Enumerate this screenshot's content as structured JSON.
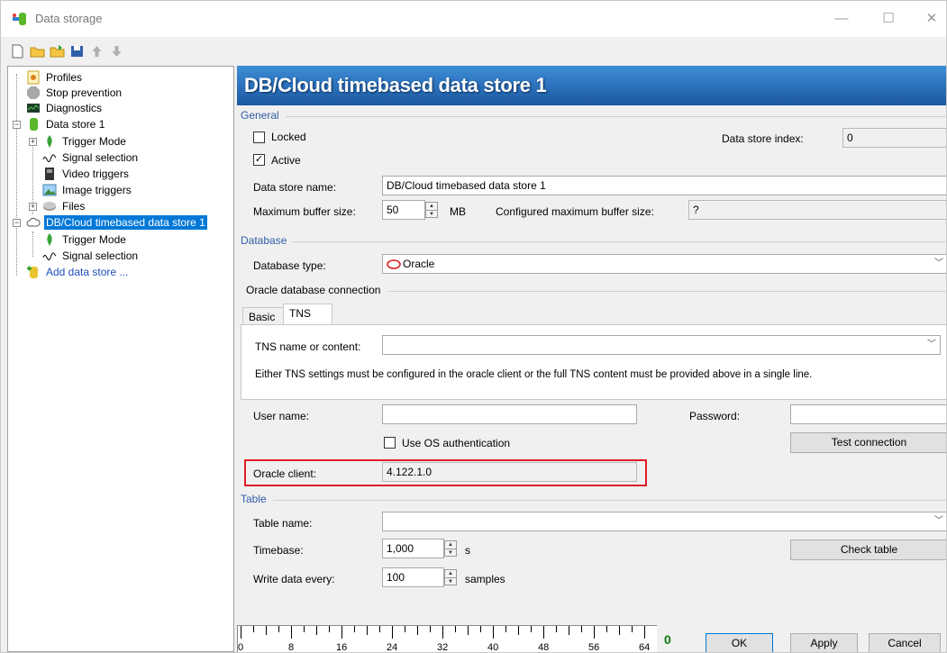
{
  "window": {
    "title": "Data storage",
    "minimize": "—",
    "maximize": "☐",
    "close": "✕"
  },
  "tree": {
    "items": [
      {
        "label": "Profiles"
      },
      {
        "label": "Stop prevention"
      },
      {
        "label": "Diagnostics"
      },
      {
        "label": "Data store 1"
      },
      {
        "label": "Trigger Mode"
      },
      {
        "label": "Signal selection"
      },
      {
        "label": "Video triggers"
      },
      {
        "label": "Image triggers"
      },
      {
        "label": "Files"
      },
      {
        "label": "DB/Cloud timebased data store 1"
      },
      {
        "label": "Trigger Mode"
      },
      {
        "label": "Signal selection"
      },
      {
        "label": "Add data store ..."
      }
    ]
  },
  "header": {
    "title": "DB/Cloud timebased data store 1"
  },
  "general": {
    "section": "General",
    "locked_label": "Locked",
    "active_label": "Active",
    "index_label": "Data store index:",
    "index_value": "0",
    "name_label": "Data store name:",
    "name_value": "DB/Cloud timebased data store 1",
    "buffer_label": "Maximum buffer size:",
    "buffer_value": "50",
    "buffer_unit": "MB",
    "configured_label": "Configured maximum buffer size:",
    "configured_value": "?"
  },
  "database": {
    "section": "Database",
    "type_label": "Database type:",
    "type_value": "Oracle",
    "connection_label": "Oracle database connection",
    "tabs": [
      {
        "label": "Basic"
      },
      {
        "label": "TNS"
      }
    ],
    "tns_label": "TNS name or content:",
    "tns_value": "",
    "tns_hint": "Either TNS settings must be configured in the oracle client or the full TNS content must be provided above in a single line.",
    "user_label": "User name:",
    "user_value": "",
    "password_label": "Password:",
    "password_value": "",
    "os_auth_label": "Use OS authentication",
    "test_button": "Test connection",
    "client_label": "Oracle client:",
    "client_value": "4.122.1.0"
  },
  "table": {
    "section": "Table",
    "name_label": "Table name:",
    "name_value": "",
    "timebase_label": "Timebase:",
    "timebase_value": "1,000",
    "timebase_unit": "s",
    "write_label": "Write data every:",
    "write_value": "100",
    "write_unit": "samples",
    "check_button": "Check table"
  },
  "ruler": {
    "labels": [
      "0",
      "8",
      "16",
      "24",
      "32",
      "40",
      "48",
      "56",
      "64"
    ]
  },
  "footer": {
    "counter": "0",
    "ok": "OK",
    "apply": "Apply",
    "cancel": "Cancel"
  }
}
